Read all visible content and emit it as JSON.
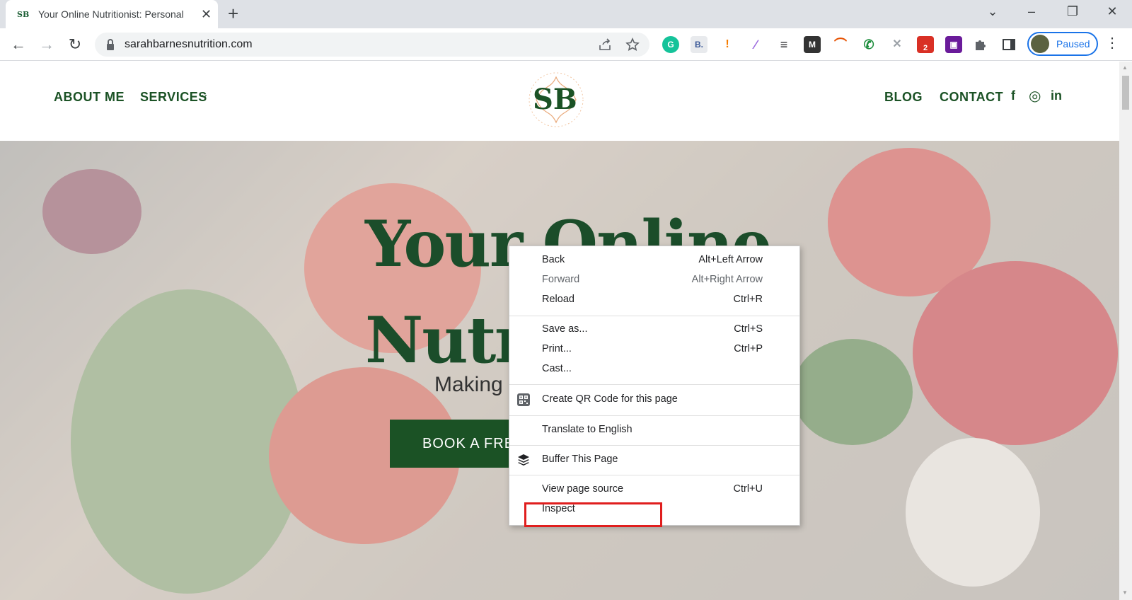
{
  "browser": {
    "tab": {
      "favicon": "SB",
      "title": "Your Online Nutritionist: Personal",
      "close": "✕"
    },
    "new_tab": "+",
    "window_controls": {
      "minimize": "–",
      "restore": "❐",
      "close": "✕",
      "tab_search": "⌄"
    },
    "nav": {
      "back": "←",
      "forward": "→",
      "reload": "↻"
    },
    "url": "sarahbarnesnutrition.com",
    "profile_label": "Paused",
    "extensions": [
      {
        "name": "grammarly",
        "label": "G",
        "color": "#15c39a"
      },
      {
        "name": "b-extension",
        "label": "B.",
        "color": "#3b5998"
      },
      {
        "name": "key-extension",
        "label": "!",
        "color": "#f57c00"
      },
      {
        "name": "pen-extension",
        "label": "∕",
        "color": "#9c6ade"
      },
      {
        "name": "buffer-extension",
        "label": "≡",
        "color": "#202124"
      },
      {
        "name": "m-extension",
        "label": "M",
        "color": "#333333"
      },
      {
        "name": "rainbow-extension",
        "label": "⌒",
        "color": "#e65100"
      },
      {
        "name": "phone-extension",
        "label": "✆",
        "color": "#1e8e3e"
      },
      {
        "name": "shield-extension",
        "label": "✕",
        "color": "#9aa0a6"
      },
      {
        "name": "badge-extension",
        "label": "2",
        "color": "#d93025"
      },
      {
        "name": "calendar-extension",
        "label": "▣",
        "color": "#6a1b9a"
      }
    ]
  },
  "site": {
    "nav_left": [
      "ABOUT ME",
      "SERVICES"
    ],
    "services_caret": "⌄",
    "logo": "SB",
    "nav_right": [
      "BLOG",
      "CONTACT"
    ],
    "social": {
      "facebook": "f",
      "instagram": "◎",
      "linkedin": "in"
    },
    "hero": {
      "title_line1": "Your Online",
      "title_line2": "Nutri",
      "subtitle": "Making",
      "cta": "BOOK A FREE"
    }
  },
  "context_menu": {
    "items": [
      {
        "label": "Back",
        "shortcut": "Alt+Left Arrow",
        "disabled": false
      },
      {
        "label": "Forward",
        "shortcut": "Alt+Right Arrow",
        "disabled": true
      },
      {
        "label": "Reload",
        "shortcut": "Ctrl+R",
        "disabled": false
      },
      {
        "label": "Save as...",
        "shortcut": "Ctrl+S",
        "disabled": false
      },
      {
        "label": "Print...",
        "shortcut": "Ctrl+P",
        "disabled": false
      },
      {
        "label": "Cast...",
        "shortcut": "",
        "disabled": false
      },
      {
        "label": "Create QR Code for this page",
        "shortcut": "",
        "disabled": false,
        "icon": "qr-code-icon"
      },
      {
        "label": "Translate to English",
        "shortcut": "",
        "disabled": false
      },
      {
        "label": "Buffer This Page",
        "shortcut": "",
        "disabled": false,
        "icon": "buffer-icon"
      },
      {
        "label": "View page source",
        "shortcut": "Ctrl+U",
        "disabled": false
      },
      {
        "label": "Inspect",
        "shortcut": "",
        "disabled": false
      }
    ],
    "highlighted_item": "Inspect",
    "highlight_color": "#e01e1e"
  }
}
